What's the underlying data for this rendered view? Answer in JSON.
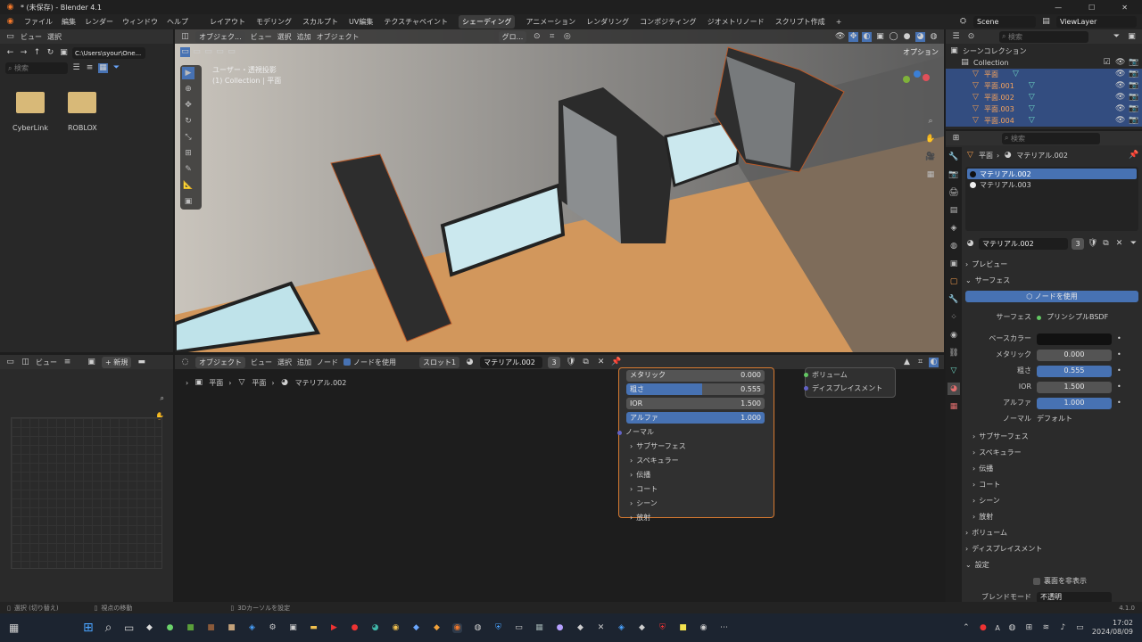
{
  "window": {
    "title": "* (未保存) - Blender 4.1",
    "minimize": "—",
    "maximize": "☐",
    "close": "✕"
  },
  "menu": [
    "ファイル",
    "編集",
    "レンダー",
    "ウィンドウ",
    "ヘルプ"
  ],
  "workspaces": [
    "レイアウト",
    "モデリング",
    "スカルプト",
    "UV編集",
    "テクスチャペイント",
    "シェーディング",
    "アニメーション",
    "レンダリング",
    "コンポジティング",
    "ジオメトリノード",
    "スクリプト作成"
  ],
  "active_workspace": "シェーディング",
  "scene": {
    "name": "Scene",
    "view_layer": "ViewLayer"
  },
  "file_browser": {
    "header": [
      "ビュー",
      "選択"
    ],
    "path": "C:\\Users\\syour\\One...",
    "search_placeholder": "検索",
    "folders": [
      "CyberLink",
      "ROBLOX"
    ]
  },
  "viewport": {
    "mode": "オブジェク...",
    "menus": [
      "ビュー",
      "選択",
      "追加",
      "オブジェクト"
    ],
    "transform": "グロ...",
    "options": "オプション",
    "info_line1": "ユーザー・透視投影",
    "info_line2": "(1) Collection | 平面"
  },
  "outliner": {
    "search_placeholder": "検索",
    "scene_collection": "シーンコレクション",
    "collection": "Collection",
    "items": [
      "平面",
      "平面.001",
      "平面.002",
      "平面.003",
      "平面.004"
    ]
  },
  "properties": {
    "search_placeholder": "検索",
    "breadcrumb_object": "平面",
    "breadcrumb_material": "マテリアル.002",
    "slots": [
      "マテリアル.002",
      "マテリアル.003"
    ],
    "material_name": "マテリアル.002",
    "user_count": "3",
    "panels": {
      "preview": "プレビュー",
      "surface": "サーフェス"
    },
    "use_nodes": "ノードを使用",
    "surface_label": "サーフェス",
    "surface_value": "プリンシプルBSDF",
    "rows": [
      {
        "label": "ベースカラー",
        "value": ""
      },
      {
        "label": "メタリック",
        "value": "0.000"
      },
      {
        "label": "粗さ",
        "value": "0.555"
      },
      {
        "label": "IOR",
        "value": "1.500"
      },
      {
        "label": "アルファ",
        "value": "1.000"
      },
      {
        "label": "ノーマル",
        "value": "デフォルト"
      }
    ],
    "subpanels": [
      "サブサーフェス",
      "スペキュラー",
      "伝播",
      "コート",
      "シーン",
      "放射"
    ],
    "volume": "ボリューム",
    "displacement": "ディスプレイスメント",
    "settings": "設定",
    "backface": "裏面を非表示",
    "blend_mode_label": "ブレンドモード",
    "blend_mode_value": "不透明",
    "version": "4.1.0"
  },
  "image_editor": {
    "view": "ビュー",
    "new": "新規"
  },
  "node_editor": {
    "mode": "オブジェクト",
    "menus": [
      "ビュー",
      "選択",
      "追加",
      "ノード"
    ],
    "use_nodes": "ノードを使用",
    "slot": "スロット1",
    "material": "マテリアル.002",
    "user_count": "3",
    "breadcrumb": [
      "平面",
      "平面",
      "マテリアル.002"
    ],
    "bsdf_rows": [
      {
        "label": "メタリック",
        "value": "0.000"
      },
      {
        "label": "粗さ",
        "value": "0.555"
      },
      {
        "label": "IOR",
        "value": "1.500"
      },
      {
        "label": "アルファ",
        "value": "1.000"
      }
    ],
    "normal": "ノーマル",
    "bsdf_panels": [
      "サブサーフェス",
      "スペキュラー",
      "伝播",
      "コート",
      "シーン",
      "放射"
    ],
    "output_volume": "ボリューム",
    "output_displacement": "ディスプレイスメント"
  },
  "status_bar": {
    "select": "選択 (切り替え)",
    "pan": "視点の移動",
    "cursor": "3Dカーソルを設定"
  },
  "taskbar": {
    "time": "17:02",
    "date": "2024/08/09",
    "lang": "A"
  }
}
